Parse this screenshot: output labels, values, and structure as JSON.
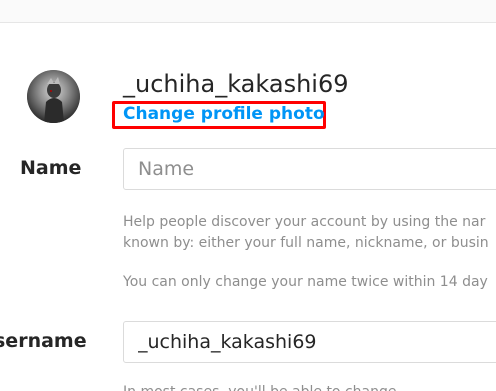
{
  "profile": {
    "username": "_uchiha_kakashi69",
    "change_photo_label": "Change profile photo"
  },
  "name_field": {
    "label": "Name",
    "placeholder": "Name",
    "help_line_1": "Help people discover your account by using the nar",
    "help_line_2": "known by: either your full name, nickname, or busin",
    "help_line_3": "You can only change your name twice within 14 day"
  },
  "username_field": {
    "label": "sername",
    "value": "_uchiha_kakashi69",
    "help_line_partial": "In most cases, you'll be able to change"
  }
}
